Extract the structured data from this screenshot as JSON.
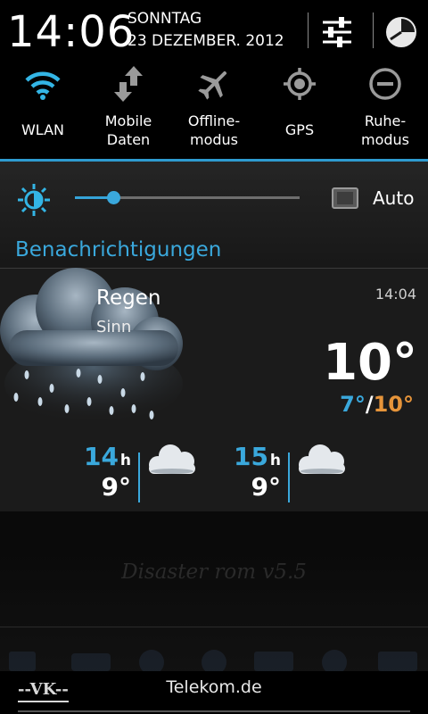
{
  "header": {
    "time": "14:06",
    "weekday": "SONNTAG",
    "date": "23 DEZEMBER. 2012",
    "settings_icon": "settings-sliders-icon",
    "profile_icon": "profile-clock-icon"
  },
  "toggles": [
    {
      "label": "WLAN",
      "icon": "wifi-icon"
    },
    {
      "label": "Mobile\nDaten",
      "icon": "mobile-data-icon"
    },
    {
      "label": "Offline-\nmodus",
      "icon": "airplane-icon"
    },
    {
      "label": "GPS",
      "icon": "gps-icon"
    },
    {
      "label": "Ruhe-\nmodus",
      "icon": "do-not-disturb-icon"
    }
  ],
  "brightness": {
    "level": 0.17,
    "auto_label": "Auto",
    "auto_checked": false
  },
  "notifications_title": "Benachrichtigungen",
  "weather": {
    "condition": "Regen",
    "location": "Sinn",
    "updated_time": "14:04",
    "temp": "10°",
    "min": "7°",
    "slash": "/",
    "max": "10°",
    "forecast": [
      {
        "hour": "14",
        "unit": "h",
        "temp": "9°",
        "icon": "cloud-icon"
      },
      {
        "hour": "15",
        "unit": "h",
        "temp": "9°",
        "icon": "cloud-icon"
      }
    ]
  },
  "watermark": "Disaster rom v5.5",
  "footer": {
    "logo": "--VK--",
    "carrier": "Telekom.de"
  },
  "colors": {
    "accent": "#3aa8dc",
    "max_temp": "#e6943a",
    "card_bg": "#1b1b1b"
  }
}
